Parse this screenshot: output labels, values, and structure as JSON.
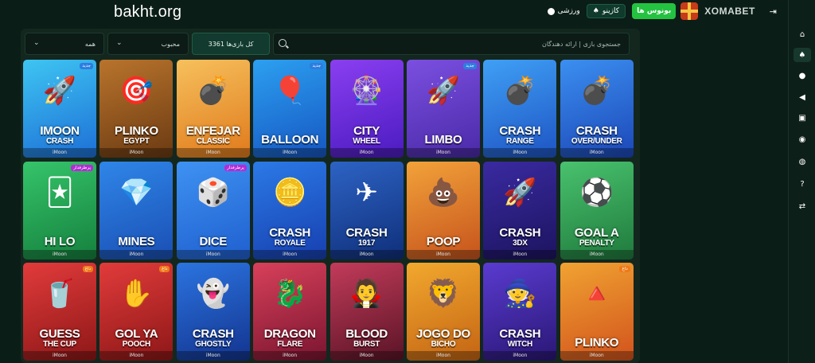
{
  "header": {
    "site": "bakht.org",
    "logo": "XOMABET",
    "bonus_label": "بونوس ها",
    "casino_label": "کازینو",
    "sports_label": "ورزشی"
  },
  "filters": {
    "all_label": "همه",
    "popular_label": "محبوب",
    "count_label": "3361 کل بازی‌ها",
    "search_placeholder": "جستجوی بازی | ارائه دهندگان"
  },
  "rail": {
    "icons": [
      "home-icon",
      "spade-icon",
      "ball-icon",
      "megaphone-icon",
      "gift-icon",
      "support-icon",
      "radio-icon",
      "help-icon",
      "swap-icon"
    ]
  },
  "games": [
    {
      "title": "iMOON",
      "sub": "CRASH",
      "provider": "iMoon",
      "badge": "جدید",
      "badge_type": "new",
      "bg": "linear-gradient(160deg,#3ec5f2,#1d6fd6)",
      "art": "🚀"
    },
    {
      "title": "PLINKO",
      "sub": "EGYPT",
      "provider": "iMoon",
      "badge": "",
      "badge_type": "",
      "bg": "linear-gradient(160deg,#b9742c,#6b3a12)",
      "art": "🎯"
    },
    {
      "title": "ENFEJAR",
      "sub": "CLASSIC",
      "provider": "iMoon",
      "badge": "",
      "badge_type": "",
      "bg": "linear-gradient(160deg,#f6c05c,#e07a1c)",
      "art": "💣"
    },
    {
      "title": "BALLOON",
      "sub": "",
      "provider": "iMoon",
      "badge": "جدید",
      "badge_type": "new",
      "bg": "linear-gradient(160deg,#2ca0f0,#1656c2)",
      "art": "🎈"
    },
    {
      "title": "CITY",
      "sub": "WHEEL",
      "provider": "iMoon",
      "badge": "",
      "badge_type": "",
      "bg": "linear-gradient(160deg,#8a3ff0,#4b1bc1)",
      "art": "🎡"
    },
    {
      "title": "LIMBO",
      "sub": "",
      "provider": "iMoon",
      "badge": "جدید",
      "badge_type": "new",
      "bg": "linear-gradient(160deg,#7b4fe0,#4a2aa8)",
      "art": "🚀"
    },
    {
      "title": "CRASH",
      "sub": "RANGE",
      "provider": "iMoon",
      "badge": "",
      "badge_type": "",
      "bg": "linear-gradient(160deg,#3fa0f5,#1e54c4)",
      "art": "💣"
    },
    {
      "title": "CRASH",
      "sub": "OVER/UNDER",
      "provider": "iMoon",
      "badge": "",
      "badge_type": "",
      "bg": "linear-gradient(160deg,#3b8ff0,#1c47b8)",
      "art": "💣"
    },
    {
      "title": "HI LO",
      "sub": "",
      "provider": "iMoon",
      "badge": "پرطرفدار",
      "badge_type": "pop",
      "bg": "linear-gradient(160deg,#35c46a,#15803d)",
      "art": "🃏"
    },
    {
      "title": "MINES",
      "sub": "",
      "provider": "iMoon",
      "badge": "",
      "badge_type": "",
      "bg": "linear-gradient(160deg,#2f86e8,#1a4fb4)",
      "art": "💎"
    },
    {
      "title": "DICE",
      "sub": "",
      "provider": "iMoon",
      "badge": "پرطرفدار",
      "badge_type": "pop",
      "bg": "linear-gradient(160deg,#3e92f2,#1f5fcf)",
      "art": "🎲"
    },
    {
      "title": "CRASH",
      "sub": "ROYALE",
      "provider": "iMoon",
      "badge": "",
      "badge_type": "",
      "bg": "linear-gradient(160deg,#2b7ae6,#173fb0)",
      "art": "🪙"
    },
    {
      "title": "CRASH",
      "sub": "1917",
      "provider": "iMoon",
      "badge": "",
      "badge_type": "",
      "bg": "linear-gradient(160deg,#2d63c4,#0f2f7a)",
      "art": "✈"
    },
    {
      "title": "POOP",
      "sub": "",
      "provider": "iMoon",
      "badge": "",
      "badge_type": "",
      "bg": "linear-gradient(160deg,#f2a23a,#c6531c)",
      "art": "💩"
    },
    {
      "title": "CRASH",
      "sub": "3DX",
      "provider": "iMoon",
      "badge": "",
      "badge_type": "",
      "bg": "linear-gradient(160deg,#3a2aa0,#1c1460)",
      "art": "🚀"
    },
    {
      "title": "GOAL A",
      "sub": "PENALTY",
      "provider": "iMoon",
      "badge": "",
      "badge_type": "",
      "bg": "linear-gradient(160deg,#49c26e,#1f7a3c)",
      "art": "⚽"
    },
    {
      "title": "GUESS",
      "sub": "THE CUP",
      "provider": "iMoon",
      "badge": "داغ",
      "badge_type": "hot",
      "bg": "linear-gradient(160deg,#e23b3b,#8d1717)",
      "art": "🥤"
    },
    {
      "title": "GOL YA",
      "sub": "POOCH",
      "provider": "iMoon",
      "badge": "داغ",
      "badge_type": "hot",
      "bg": "linear-gradient(160deg,#e23b3b,#8d1717)",
      "art": "✋"
    },
    {
      "title": "CRASH",
      "sub": "GHOSTLY",
      "provider": "iMoon",
      "badge": "",
      "badge_type": "",
      "bg": "linear-gradient(160deg,#2b74e0,#13348f)",
      "art": "👻"
    },
    {
      "title": "DRAGON",
      "sub": "FLARE",
      "provider": "iMoon",
      "badge": "",
      "badge_type": "",
      "bg": "linear-gradient(160deg,#d8405a,#7a1530)",
      "art": "🐉"
    },
    {
      "title": "BLOOD",
      "sub": "BURST",
      "provider": "iMoon",
      "badge": "",
      "badge_type": "",
      "bg": "linear-gradient(160deg,#c23b5a,#5a1426)",
      "art": "🧛"
    },
    {
      "title": "JOGO DO",
      "sub": "BICHO",
      "provider": "iMoon",
      "badge": "",
      "badge_type": "",
      "bg": "linear-gradient(160deg,#f2a92e,#c46414)",
      "art": "🦁"
    },
    {
      "title": "CRASH",
      "sub": "WITCH",
      "provider": "iMoon",
      "badge": "",
      "badge_type": "",
      "bg": "linear-gradient(160deg,#5a3bd0,#2a1775)",
      "art": "🧙"
    },
    {
      "title": "PLINKO",
      "sub": "",
      "provider": "iMoon",
      "badge": "داغ",
      "badge_type": "hot",
      "bg": "linear-gradient(160deg,#f0a332,#d2531c)",
      "art": "🔺"
    }
  ]
}
